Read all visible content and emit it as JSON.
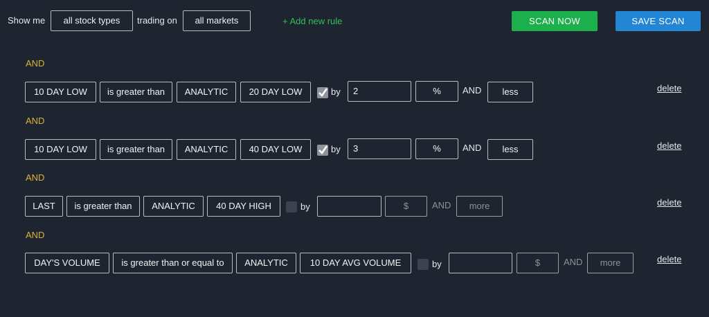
{
  "header": {
    "show_me_label": "Show me",
    "stock_types_value": "all stock types",
    "trading_on_label": "trading on",
    "markets_value": "all markets",
    "add_rule_label": "+ Add new rule",
    "scan_now_label": "SCAN NOW",
    "save_scan_label": "SAVE SCAN"
  },
  "rules": [
    {
      "connector": "AND",
      "field": "10 DAY LOW",
      "operator": "is greater than",
      "compare_type": "ANALYTIC",
      "compare_value": "20 DAY LOW",
      "by_checked": true,
      "by_label": "by",
      "amount": "2",
      "unit": "%",
      "and_label": "AND",
      "direction": "less",
      "delete_label": "delete"
    },
    {
      "connector": "AND",
      "field": "10 DAY LOW",
      "operator": "is greater than",
      "compare_type": "ANALYTIC",
      "compare_value": "40 DAY LOW",
      "by_checked": true,
      "by_label": "by",
      "amount": "3",
      "unit": "%",
      "and_label": "AND",
      "direction": "less",
      "delete_label": "delete"
    },
    {
      "connector": "AND",
      "field": "LAST",
      "operator": "is greater than",
      "compare_type": "ANALYTIC",
      "compare_value": "40 DAY HIGH",
      "by_checked": false,
      "by_label": "by",
      "amount": "",
      "unit": "$",
      "and_label": "AND",
      "direction": "more",
      "delete_label": "delete"
    },
    {
      "connector": "AND",
      "field": "DAY'S VOLUME",
      "operator": "is greater than or equal to",
      "compare_type": "ANALYTIC",
      "compare_value": "10 DAY AVG VOLUME",
      "by_checked": false,
      "by_label": "by",
      "amount": "",
      "unit": "$",
      "and_label": "AND",
      "direction": "more",
      "delete_label": "delete"
    }
  ],
  "colors": {
    "background": "#1f2530",
    "connector": "#d9b23a",
    "add_rule": "#2ec05a",
    "scan_now": "#1cb04c",
    "save_scan": "#2386d4"
  }
}
